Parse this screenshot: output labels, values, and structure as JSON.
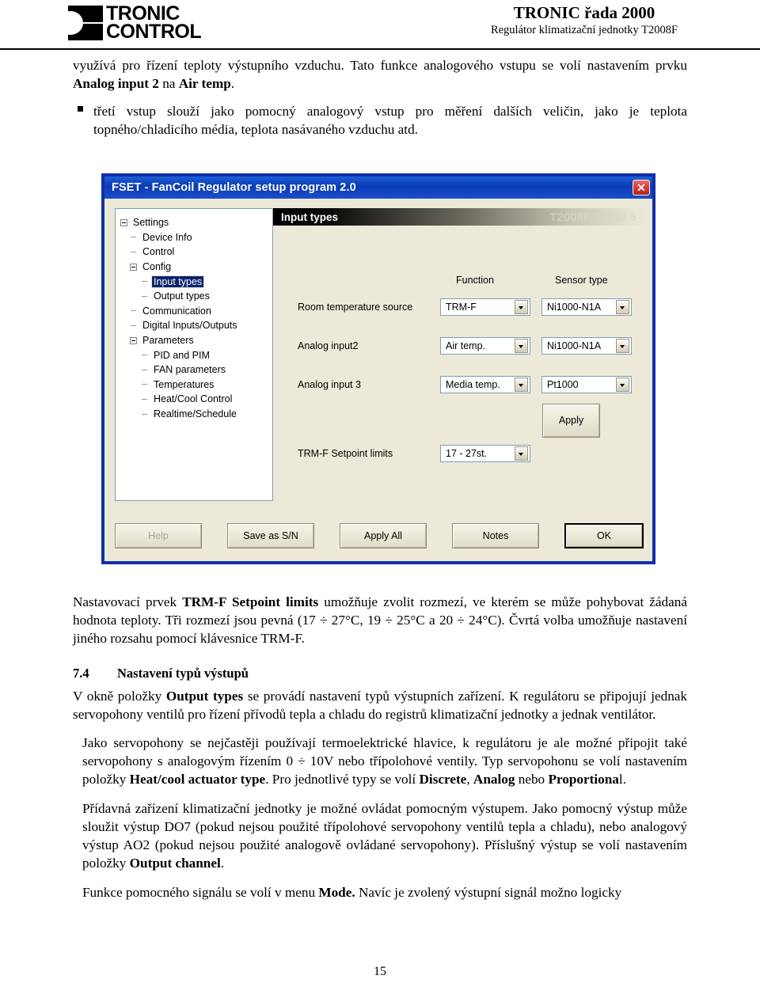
{
  "header": {
    "logo_line1": "TRONIC",
    "logo_line2": "CONTROL",
    "title": "TRONIC řada 2000",
    "subtitle": "Regulátor klimatizační jednotky T2008F"
  },
  "top_text": {
    "para1_a": "využívá pro řízení teploty výstupního vzduchu. Tato funkce analogového vstupu se volí nastavením prvku ",
    "para1_bold1": "Analog input 2",
    "para1_b": " na ",
    "para1_bold2": "Air temp",
    "para1_c": ".",
    "bullet1": "třetí vstup slouží jako pomocný analogový vstup pro měření dalších veličin, jako je teplota topného/chladicího média, teplota nasávaného vzduchu atd."
  },
  "dialog": {
    "titlebar": "FSET - FanCoil Regulator setup program 2.0",
    "close_label": "✕",
    "section_title": "Input types",
    "device_model": "T2008F-T, FW 5",
    "tree": [
      {
        "label": "Settings",
        "level": 0,
        "expander": "minus"
      },
      {
        "label": "Device Info",
        "level": 1,
        "expander": "dash"
      },
      {
        "label": "Control",
        "level": 1,
        "expander": "dash"
      },
      {
        "label": "Config",
        "level": 1,
        "expander": "minus"
      },
      {
        "label": "Input types",
        "level": 2,
        "expander": "dash",
        "selected": true
      },
      {
        "label": "Output types",
        "level": 2,
        "expander": "dash"
      },
      {
        "label": "Communication",
        "level": 1,
        "expander": "dash"
      },
      {
        "label": "Digital Inputs/Outputs",
        "level": 1,
        "expander": "dash"
      },
      {
        "label": "Parameters",
        "level": 1,
        "expander": "minus"
      },
      {
        "label": "PID and PIM",
        "level": 2,
        "expander": "dash"
      },
      {
        "label": "FAN parameters",
        "level": 2,
        "expander": "dash"
      },
      {
        "label": "Temperatures",
        "level": 2,
        "expander": "dash"
      },
      {
        "label": "Heat/Cool Control",
        "level": 2,
        "expander": "dash"
      },
      {
        "label": "Realtime/Schedule",
        "level": 2,
        "expander": "dash"
      }
    ],
    "columns": {
      "function": "Function",
      "sensor_type": "Sensor type"
    },
    "rows": [
      {
        "label": "Room temperature source",
        "function": "TRM-F",
        "sensor": "Ni1000-N1A"
      },
      {
        "label": "Analog input2",
        "function": "Air temp.",
        "sensor": "Ni1000-N1A"
      },
      {
        "label": "Analog input 3",
        "function": "Media temp.",
        "sensor": "Pt1000"
      }
    ],
    "setpoint": {
      "label": "TRM-F Setpoint limits",
      "value": "17 - 27st."
    },
    "apply_label": "Apply",
    "buttons": {
      "help": "Help",
      "save_as_sn": "Save as S/N",
      "apply_all": "Apply All",
      "notes": "Notes",
      "ok": "OK"
    },
    "colors": {
      "titlebar_blue": "#0a3bb5",
      "dialog_face": "#ece9d8",
      "selection_blue": "#0a246a",
      "close_red": "#d8392f"
    }
  },
  "lower_text": {
    "para2_a": "Nastavovací prvek ",
    "para2_bold": "TRM-F Setpoint limits",
    "para2_b": " umožňuje zvolit rozmezí, ve kterém se může pohybovat žádaná hodnota teploty. Tři rozmezí jsou pevná (17 ÷ 27°C, 19 ÷ 25°C a 20 ÷ 24°C). Čvrtá volba umožňuje nastavení jiného rozsahu pomocí klávesnice TRM-F.",
    "section_number": "7.4",
    "section_title": "Nastavení typů výstupů",
    "para3_a": "V okně položky ",
    "para3_bold": "Output types",
    "para3_b": " se provádí nastavení typů výstupních zařízení. K regulátoru se připojují jednak servopohony ventilů pro řízení přívodů tepla a chladu do registrů klimatizační jednotky a jednak ventilátor.",
    "para4_a": "Jako servopohony se nejčastěji používají  termoelektrické hlavice, k regulátoru je ale možné připojit také servopohony s analogovým řízením 0 ÷ 10V nebo třípolohové ventily. Typ servopohonu se volí nastavením položky ",
    "para4_bold1": "Heat/cool actuator type",
    "para4_b": ". Pro jednotlivé typy se volí ",
    "para4_bold2": "Discrete",
    "para4_c": ", ",
    "para4_bold3": "Analog",
    "para4_d": " nebo ",
    "para4_bold4": "Proportiona",
    "para4_e": "l.",
    "para5_a": "Přídavná zařízení klimatizační jednotky je možné ovládat pomocným výstupem. Jako pomocný výstup může sloužit výstup DO7 (pokud nejsou použité  třípolohové servopohony ventilů tepla a chladu), nebo analogový výstup AO2 (pokud nejsou použité analogově ovládané servopohony). Příslušný výstup se volí nastavením položky ",
    "para5_bold": "Output channel",
    "para5_b": ".",
    "para6_a": "Funkce pomocného signálu se volí v menu ",
    "para6_bold": "Mode.",
    "para6_b": " Navíc je zvolený výstupní signál možno logicky"
  },
  "page_number": "15"
}
